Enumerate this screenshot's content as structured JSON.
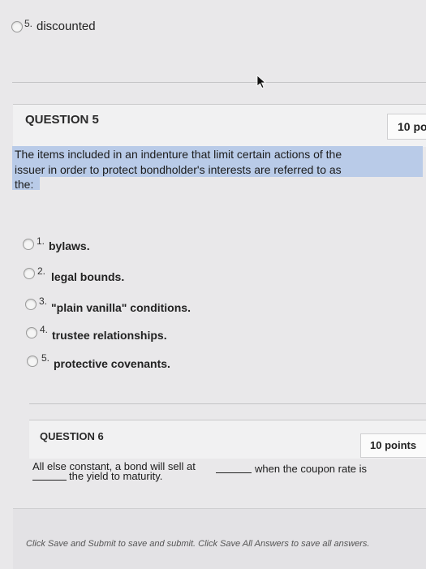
{
  "prev_question": {
    "option5": {
      "number": "5.",
      "label": "discounted"
    }
  },
  "question5": {
    "title": "QUESTION 5",
    "points": "10 po",
    "prompt_line1": "The items included in an indenture that limit certain actions of the",
    "prompt_line2": "issuer in order to protect bondholder's interests are referred to as",
    "prompt_line3": "the:",
    "options": [
      {
        "number": "1.",
        "label": "bylaws."
      },
      {
        "number": "2.",
        "label": "legal bounds."
      },
      {
        "number": "3.",
        "label": "\"plain vanilla\" conditions."
      },
      {
        "number": "4.",
        "label": "trustee relationships."
      },
      {
        "number": "5.",
        "label": "protective covenants."
      }
    ]
  },
  "question6": {
    "title": "QUESTION 6",
    "points": "10 points",
    "prompt_part1": "All else constant, a bond will sell at",
    "prompt_part2": "when the coupon rate is",
    "prompt_part3": "the yield to maturity."
  },
  "footer": {
    "instruction": "Click Save and Submit to save and submit. Click Save All Answers to save all answers."
  }
}
